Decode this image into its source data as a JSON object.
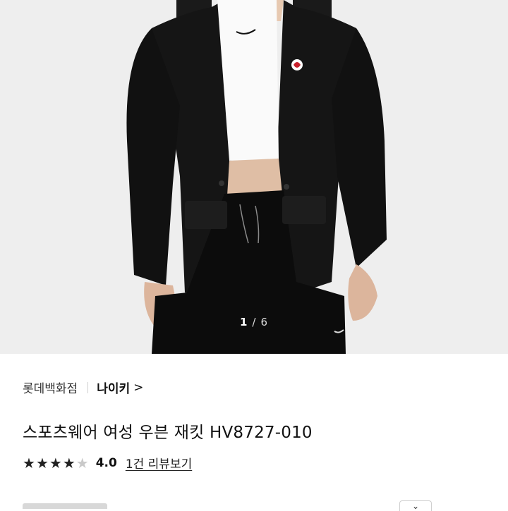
{
  "gallery": {
    "current": "1",
    "separator": "/",
    "total": "6"
  },
  "seller": {
    "store": "롯데백화점",
    "brand": "나이키",
    "brand_chevron": ">"
  },
  "product": {
    "title": "스포츠웨어 여성 우븐 재킷 HV8727-010"
  },
  "rating": {
    "stars_filled": 4,
    "stars_total": 5,
    "star_glyph": "★",
    "score": "4.0",
    "reviews_label": "1건 리뷰보기"
  },
  "colors": {
    "jacket": "#141414",
    "background": "#efefef",
    "badge_red": "#c8202c"
  },
  "icons": {
    "brand_chevron": "chevron-right-icon",
    "dropdown": "chevron-down-icon"
  }
}
